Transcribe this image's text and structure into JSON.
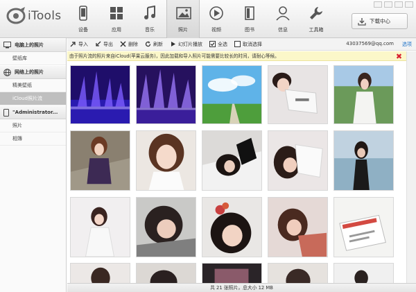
{
  "app": {
    "name": "iTools"
  },
  "tabs": [
    {
      "label": "设备",
      "icon": "phone-icon"
    },
    {
      "label": "应用",
      "icon": "apps-icon"
    },
    {
      "label": "音乐",
      "icon": "music-icon"
    },
    {
      "label": "照片",
      "icon": "photo-icon",
      "active": true
    },
    {
      "label": "视频",
      "icon": "video-icon"
    },
    {
      "label": "图书",
      "icon": "book-icon"
    },
    {
      "label": "信息",
      "icon": "person-icon"
    },
    {
      "label": "工具箱",
      "icon": "wrench-icon"
    }
  ],
  "download_center": {
    "label": "下载中心",
    "icon": "download-icon"
  },
  "sidebar": {
    "sections": [
      {
        "label": "电脑上的照片",
        "icon": "monitor-icon",
        "items": [
          {
            "label": "壁纸库"
          }
        ]
      },
      {
        "label": "网络上的照片",
        "icon": "globe-icon",
        "items": [
          {
            "label": "精美壁纸"
          },
          {
            "label": "iCloud照片流",
            "active": true
          }
        ]
      },
      {
        "label": "\"Administrator...",
        "icon": "phone-icon",
        "items": [
          {
            "label": "照片"
          },
          {
            "label": "相簿"
          }
        ]
      }
    ]
  },
  "toolbar": {
    "buttons": [
      {
        "label": "导入",
        "icon": "import-icon"
      },
      {
        "label": "导出",
        "icon": "export-icon"
      },
      {
        "label": "删除",
        "icon": "delete-icon"
      },
      {
        "label": "刷新",
        "icon": "refresh-icon"
      },
      {
        "label": "幻灯片播放",
        "icon": "play-icon"
      },
      {
        "label": "全选",
        "icon": "checkbox-checked-icon"
      },
      {
        "label": "取消选择",
        "icon": "checkbox-icon"
      }
    ],
    "account": "43037569@qq.com",
    "options": "选项"
  },
  "notice": {
    "text": "由于照片流的照片来自iCloud(苹果云服务)，因此加载和导入照片可能需要比较长的时间，请耐心等候。",
    "close_icon": "close-icon"
  },
  "status": {
    "text": "共 21 张照片，总大小 12 MB"
  },
  "colors": {
    "accent": "#1d72c8",
    "notice_bg": "#fbf7c9",
    "close": "#d9202f",
    "active_item": "#bfbfbf"
  }
}
